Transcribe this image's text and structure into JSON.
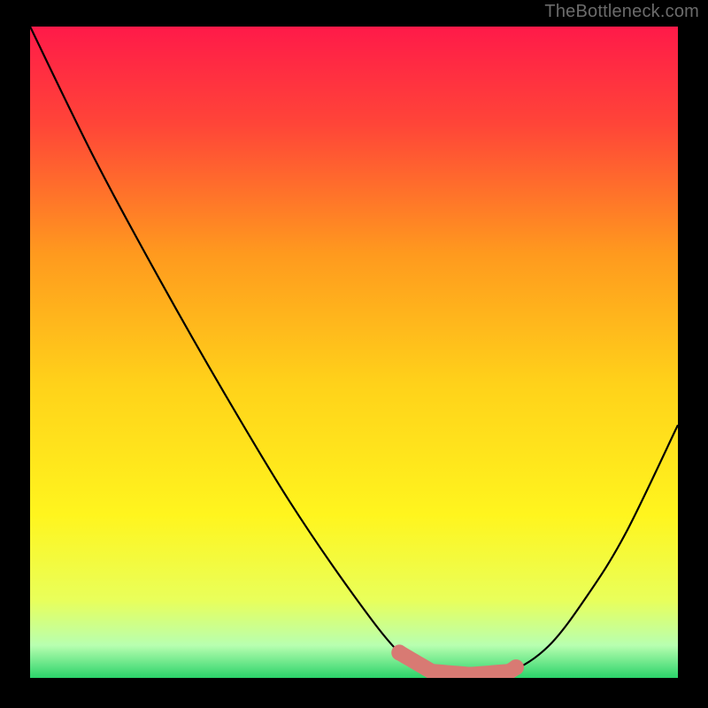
{
  "watermark": "TheBottleneck.com",
  "chart_data": {
    "type": "line",
    "title": "",
    "xlabel": "",
    "ylabel": "",
    "xlim": [
      0,
      100
    ],
    "ylim": [
      0,
      100
    ],
    "gradient_stops": [
      {
        "offset": 0.0,
        "color": "#ff1a49"
      },
      {
        "offset": 0.15,
        "color": "#ff4538"
      },
      {
        "offset": 0.35,
        "color": "#ff9a1e"
      },
      {
        "offset": 0.55,
        "color": "#ffd21a"
      },
      {
        "offset": 0.75,
        "color": "#fff51e"
      },
      {
        "offset": 0.88,
        "color": "#e9ff5a"
      },
      {
        "offset": 0.95,
        "color": "#b8ffb0"
      },
      {
        "offset": 1.0,
        "color": "#2bd36a"
      }
    ],
    "curve_points": [
      {
        "x": 0,
        "y": 103
      },
      {
        "x": 10,
        "y": 82
      },
      {
        "x": 20,
        "y": 63
      },
      {
        "x": 30,
        "y": 45
      },
      {
        "x": 40,
        "y": 28
      },
      {
        "x": 50,
        "y": 13
      },
      {
        "x": 57,
        "y": 4
      },
      {
        "x": 62,
        "y": 1
      },
      {
        "x": 68,
        "y": 0.5
      },
      {
        "x": 74,
        "y": 1
      },
      {
        "x": 80,
        "y": 5
      },
      {
        "x": 86,
        "y": 13
      },
      {
        "x": 92,
        "y": 23
      },
      {
        "x": 100,
        "y": 40
      }
    ],
    "highlight_band": {
      "x_start": 57,
      "x_end": 75,
      "y": 0.8,
      "color": "#d87a73",
      "thickness": 2.5
    }
  }
}
